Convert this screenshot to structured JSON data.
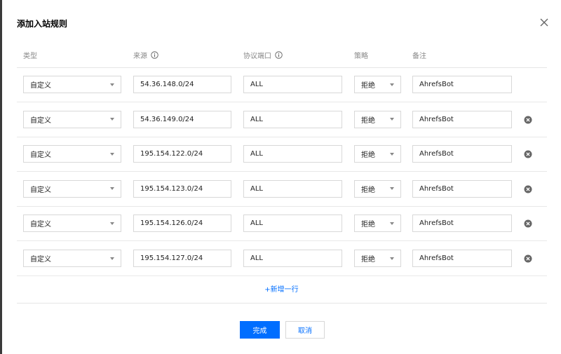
{
  "dialog": {
    "title": "添加入站规则",
    "close_icon": "close-icon"
  },
  "headers": {
    "type": "类型",
    "source": "来源",
    "port": "协议端口",
    "policy": "策略",
    "note": "备注"
  },
  "rows": [
    {
      "type": "自定义",
      "source": "54.36.148.0/24",
      "port": "ALL",
      "policy": "拒绝",
      "note": "AhrefsBot",
      "deletable": false
    },
    {
      "type": "自定义",
      "source": "54.36.149.0/24",
      "port": "ALL",
      "policy": "拒绝",
      "note": "AhrefsBot",
      "deletable": true
    },
    {
      "type": "自定义",
      "source": "195.154.122.0/24",
      "port": "ALL",
      "policy": "拒绝",
      "note": "AhrefsBot",
      "deletable": true
    },
    {
      "type": "自定义",
      "source": "195.154.123.0/24",
      "port": "ALL",
      "policy": "拒绝",
      "note": "AhrefsBot",
      "deletable": true
    },
    {
      "type": "自定义",
      "source": "195.154.126.0/24",
      "port": "ALL",
      "policy": "拒绝",
      "note": "AhrefsBot",
      "deletable": true
    },
    {
      "type": "自定义",
      "source": "195.154.127.0/24",
      "port": "ALL",
      "policy": "拒绝",
      "note": "AhrefsBot",
      "deletable": true
    }
  ],
  "add_row_label": "+新增一行",
  "buttons": {
    "ok": "完成",
    "cancel": "取消"
  },
  "colors": {
    "accent": "#006eff",
    "border": "#d8d8d8"
  }
}
